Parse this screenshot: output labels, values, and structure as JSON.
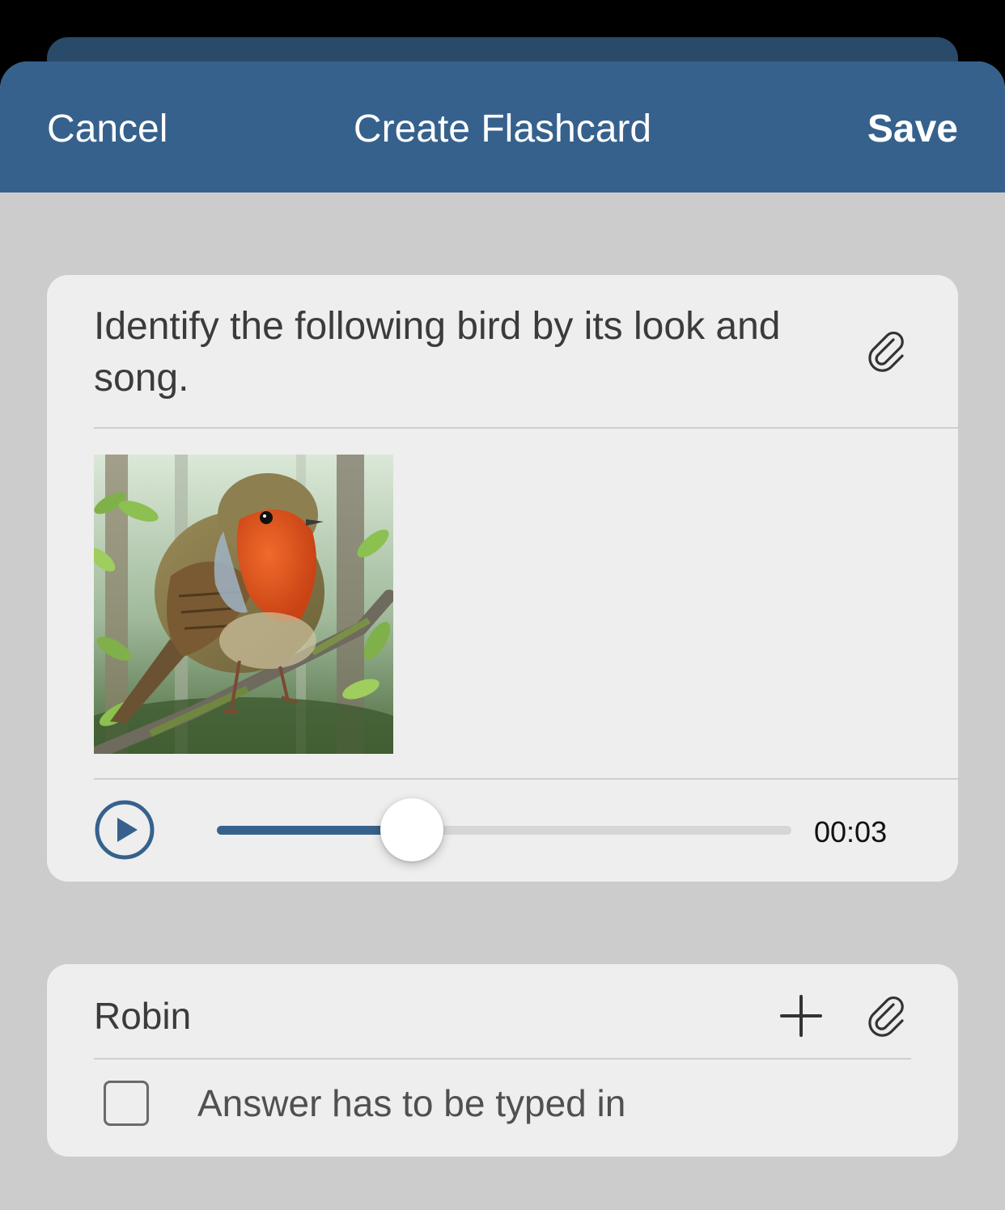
{
  "navbar": {
    "cancel_label": "Cancel",
    "title": "Create Flashcard",
    "save_label": "Save"
  },
  "question": {
    "text": "Identify the following bird by its look and song.",
    "image_subject": "robin on a branch",
    "audio": {
      "time": "00:03",
      "progress": 0.34
    }
  },
  "answer": {
    "value": "Robin",
    "typed_in_label": "Answer has to be typed in",
    "typed_in_checked": false
  },
  "icons": {
    "attach": "paperclip-icon",
    "add": "plus-icon",
    "play": "play-icon"
  },
  "colors": {
    "accent": "#36618c",
    "background": "#cccccc",
    "card": "#eeeeee"
  }
}
